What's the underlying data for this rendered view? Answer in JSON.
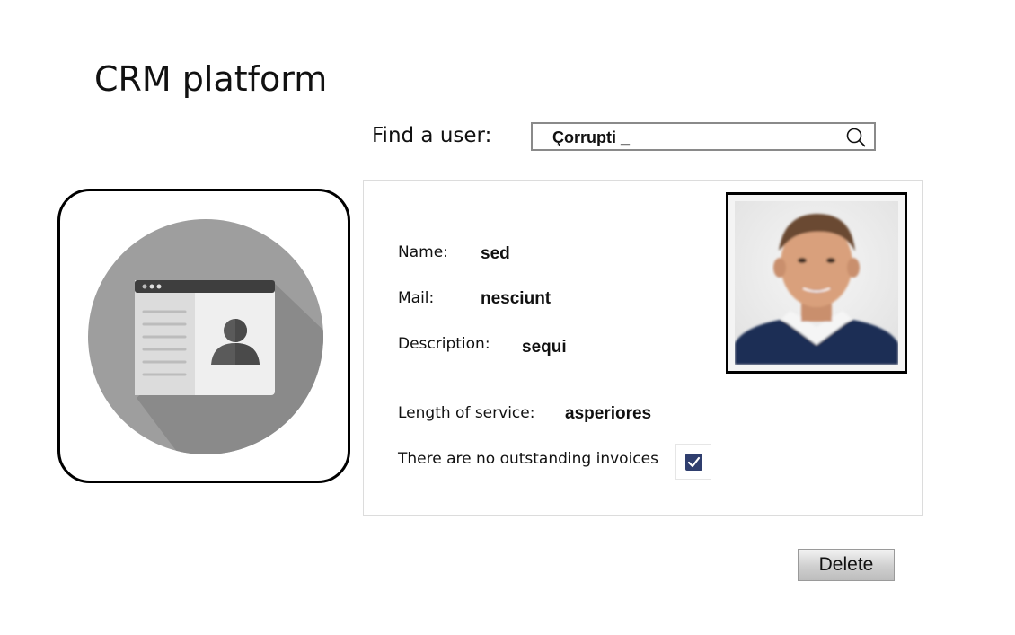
{
  "app": {
    "title": "CRM platform"
  },
  "search": {
    "label": "Find a user:",
    "value": "Çorrupti _",
    "icon": "search-icon"
  },
  "avatar": {
    "icon": "contact-card-icon"
  },
  "user": {
    "fields": {
      "name": {
        "label": "Name:",
        "value": "sed"
      },
      "mail": {
        "label": "Mail:",
        "value": "nesciunt"
      },
      "description": {
        "label": "Description:",
        "value": "sequi"
      },
      "length_of_service": {
        "label": "Length of service:",
        "value": "asperiores"
      }
    },
    "invoices": {
      "label": "There are no outstanding invoices",
      "checked": true
    },
    "photo": "user-photo"
  },
  "actions": {
    "delete_label": "Delete"
  },
  "colors": {
    "checkbox": "#2f3e6e",
    "avatar_circle": "#9e9e9e"
  }
}
